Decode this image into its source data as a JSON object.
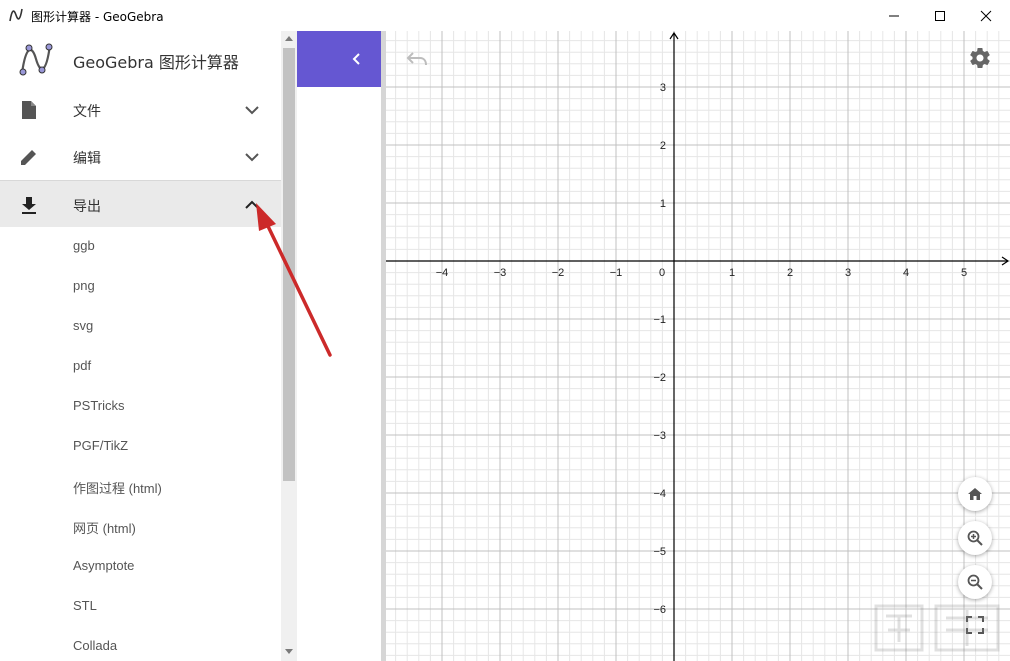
{
  "window": {
    "title": "图形计算器 - GeoGebra",
    "controls": [
      "minimize-icon",
      "maximize-icon",
      "close-icon"
    ]
  },
  "sidebar": {
    "app_name": "GeoGebra 图形计算器",
    "menu": [
      {
        "label": "文件",
        "icon": "file-icon",
        "expanded": false
      },
      {
        "label": "编辑",
        "icon": "pencil-icon",
        "expanded": false
      },
      {
        "label": "导出",
        "icon": "download-icon",
        "expanded": true
      }
    ],
    "export_items": [
      "ggb",
      "png",
      "svg",
      "pdf",
      "PSTricks",
      "PGF/TikZ",
      "作图过程 (html)",
      "网页 (html)",
      "Asymptote",
      "STL",
      "Collada"
    ]
  },
  "graphics": {
    "x_ticks": [
      "−4",
      "−3",
      "−2",
      "−1",
      "0",
      "1",
      "2",
      "3",
      "4",
      "5"
    ],
    "y_ticks": [
      "3",
      "2",
      "1",
      "−1",
      "−2",
      "−3",
      "−4",
      "−5",
      "−6"
    ],
    "buttons": [
      "undo-icon",
      "settings-icon",
      "home-icon",
      "zoom-in-icon",
      "zoom-out-icon",
      "fullscreen-icon"
    ]
  },
  "colors": {
    "accent": "#6557d2",
    "annotation_arrow": "#cc2a2a",
    "grid_major": "#c0c0c0",
    "grid_minor": "#e6e6e6"
  }
}
